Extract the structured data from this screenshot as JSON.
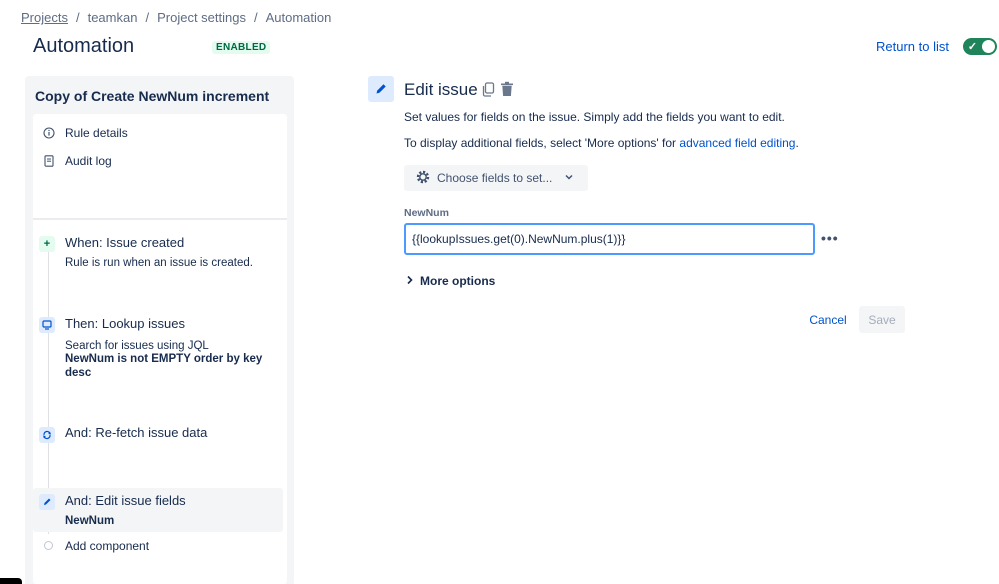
{
  "breadcrumb": {
    "projects": "Projects",
    "project": "teamkan",
    "settings": "Project settings",
    "current": "Automation",
    "separator": "/"
  },
  "header": {
    "title": "Automation",
    "status_badge": "ENABLED",
    "return_link": "Return to list",
    "toggle_on": true
  },
  "colors": {
    "accent": "#0052cc",
    "toggle_on": "#1f845a",
    "badge_bg": "#e3fcef",
    "badge_text": "#006644",
    "focus": "#4c9aff"
  },
  "sidebar": {
    "rule_name": "Copy of Create NewNum increment",
    "nav": [
      {
        "label": "Rule details",
        "icon": "info-icon"
      },
      {
        "label": "Audit log",
        "icon": "document-icon"
      }
    ],
    "steps": [
      {
        "title": "When: Issue created",
        "description": "Rule is run when an issue is created.",
        "icon": "plus-icon"
      },
      {
        "title": "Then: Lookup issues",
        "description": "Search for issues using JQL",
        "detail": "NewNum is not EMPTY order by key desc",
        "icon": "search-issues-icon"
      },
      {
        "title": "And: Re-fetch issue data",
        "icon": "refresh-icon"
      },
      {
        "title": "And: Edit issue fields",
        "detail": "NewNum",
        "icon": "pencil-icon",
        "selected": true
      }
    ],
    "add_component": "Add component"
  },
  "main": {
    "title": "Edit issue",
    "description_1": "Set values for fields on the issue. Simply add the fields you want to edit.",
    "description_2_prefix": "To display additional fields, select 'More options' for ",
    "description_2_link": "advanced field editing",
    "description_2_suffix": ".",
    "choose_fields": "Choose fields to set...",
    "field_label": "NewNum",
    "field_value": "{{lookupIssues.get(0).NewNum.plus(1)}}",
    "more_options": "More options",
    "cancel": "Cancel",
    "save": "Save"
  }
}
